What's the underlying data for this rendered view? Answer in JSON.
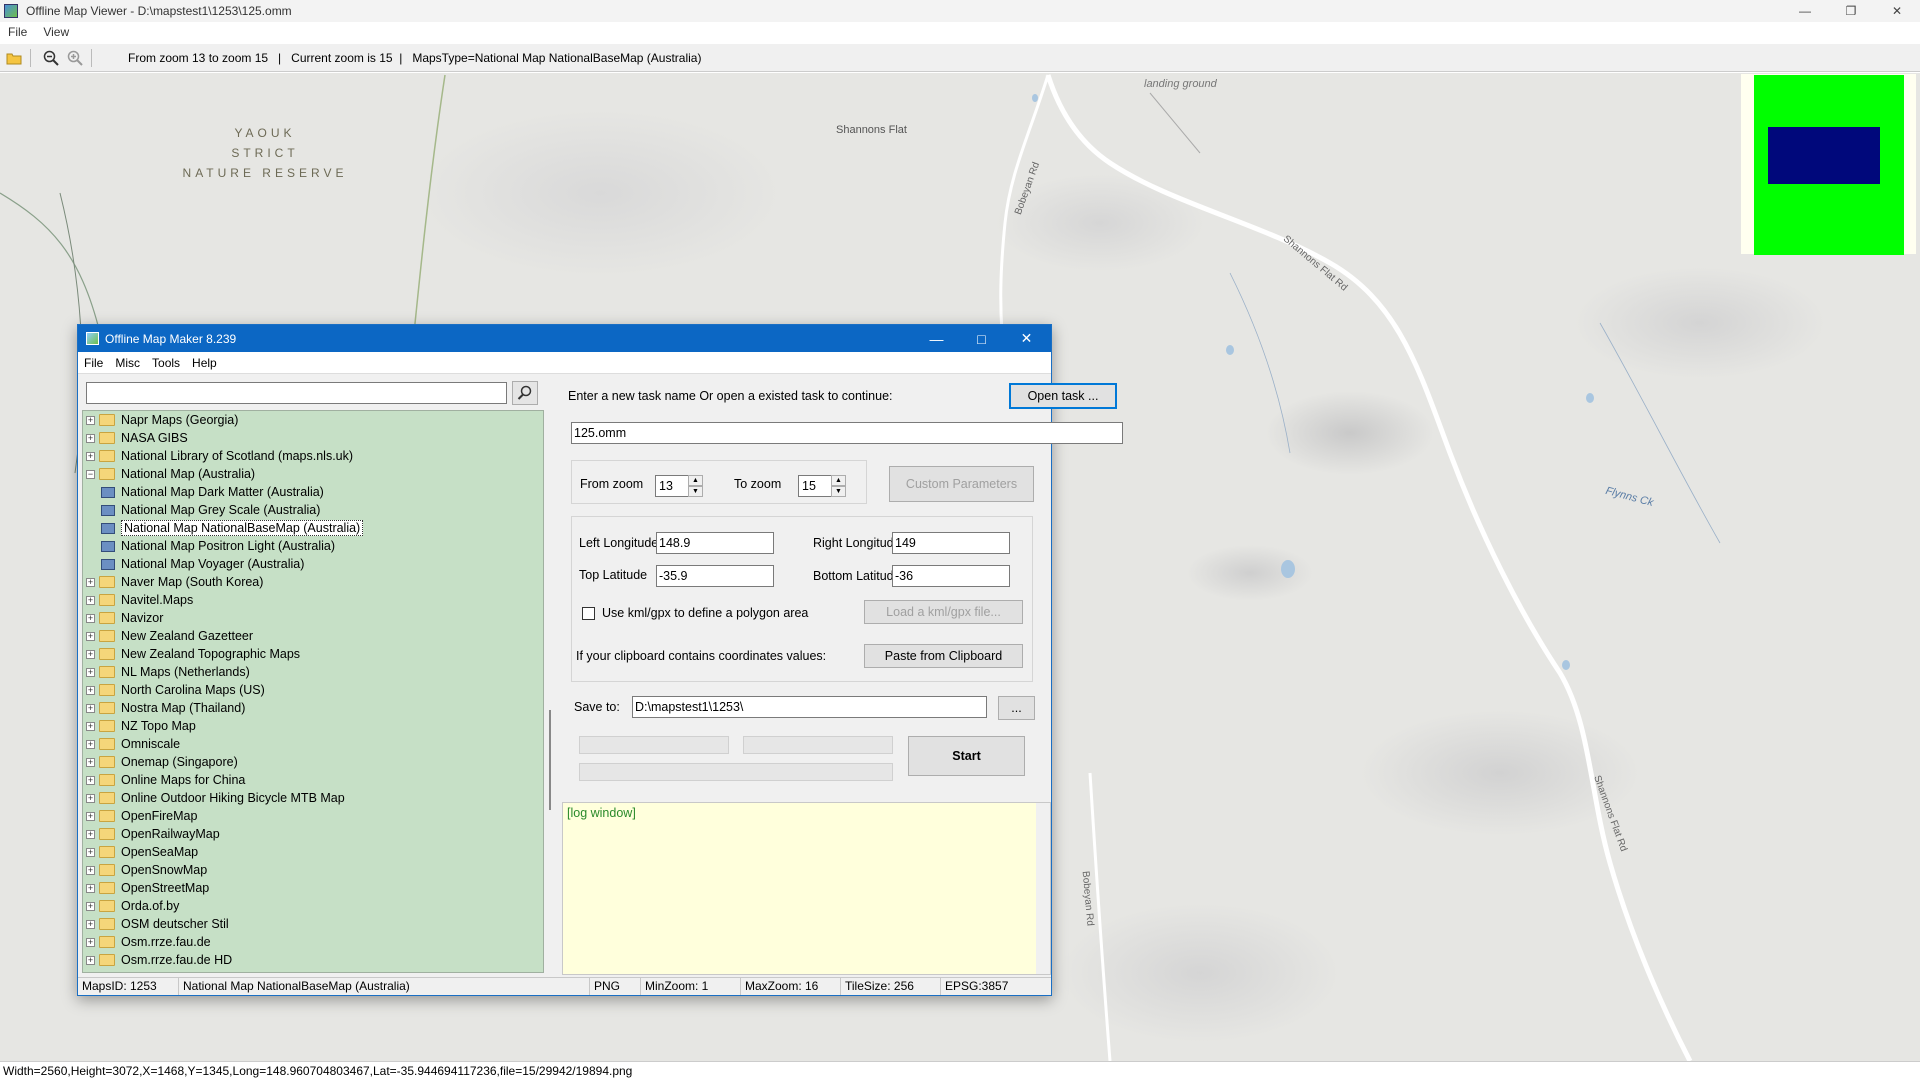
{
  "outer": {
    "title": "Offline Map Viewer - D:\\mapstest1\\1253\\125.omm",
    "menu": [
      "File",
      "View"
    ],
    "toolbar_info": "From zoom 13 to zoom 15   |   Current zoom is 15  |   MapsType=National Map NationalBaseMap (Australia)",
    "status": "Width=2560,Height=3072,X=1468,Y=1345,Long=148.960704803467,Lat=-35.944694117236,file=15/29942/19894.png"
  },
  "map_labels": {
    "reserve": [
      "YAOUK",
      "STRICT",
      "NATURE RESERVE"
    ],
    "shannons_flat": "Shannons Flat",
    "landing_ground": "landing ground",
    "bobeyan_rd": "Bobeyan Rd",
    "shannons_flat_rd": "Shannons Flat Rd",
    "flynns_ck": "Flynns Ck"
  },
  "minimap_colors": {
    "frame": "#00ff00",
    "viewport": "#00087b"
  },
  "dialog": {
    "title": "Offline Map Maker 8.239",
    "menu": [
      "File",
      "Misc",
      "Tools",
      "Help"
    ],
    "search_placeholder": "",
    "tree": [
      {
        "label": "Napr Maps (Georgia)",
        "type": "folder"
      },
      {
        "label": "NASA GIBS",
        "type": "folder"
      },
      {
        "label": "National Library of Scotland (maps.nls.uk)",
        "type": "folder"
      },
      {
        "label": "National Map (Australia)",
        "type": "folder-open"
      },
      {
        "label": "National Map Dark Matter (Australia)",
        "type": "map"
      },
      {
        "label": "National Map Grey Scale (Australia)",
        "type": "map"
      },
      {
        "label": "National Map NationalBaseMap (Australia)",
        "type": "map",
        "selected": true
      },
      {
        "label": "National Map Positron Light (Australia)",
        "type": "map"
      },
      {
        "label": "National Map Voyager (Australia)",
        "type": "map"
      },
      {
        "label": "Naver Map (South Korea)",
        "type": "folder"
      },
      {
        "label": "Navitel.Maps",
        "type": "folder"
      },
      {
        "label": "Navizor",
        "type": "folder"
      },
      {
        "label": "New Zealand Gazetteer",
        "type": "folder"
      },
      {
        "label": "New Zealand Topographic Maps",
        "type": "folder"
      },
      {
        "label": "NL Maps (Netherlands)",
        "type": "folder"
      },
      {
        "label": "North Carolina Maps (US)",
        "type": "folder"
      },
      {
        "label": "Nostra Map (Thailand)",
        "type": "folder"
      },
      {
        "label": "NZ Topo Map",
        "type": "folder"
      },
      {
        "label": "Omniscale",
        "type": "folder"
      },
      {
        "label": "Onemap (Singapore)",
        "type": "folder"
      },
      {
        "label": "Online Maps for China",
        "type": "folder"
      },
      {
        "label": "Online Outdoor Hiking Bicycle MTB Map",
        "type": "folder"
      },
      {
        "label": "OpenFireMap",
        "type": "folder"
      },
      {
        "label": "OpenRailwayMap",
        "type": "folder"
      },
      {
        "label": "OpenSeaMap",
        "type": "folder"
      },
      {
        "label": "OpenSnowMap",
        "type": "folder"
      },
      {
        "label": "OpenStreetMap",
        "type": "folder"
      },
      {
        "label": "Orda.of.by",
        "type": "folder"
      },
      {
        "label": "OSM deutscher Stil",
        "type": "folder"
      },
      {
        "label": "Osm.rrze.fau.de",
        "type": "folder"
      },
      {
        "label": "Osm.rrze.fau.de HD",
        "type": "folder"
      }
    ],
    "task_prompt": "Enter a new task name Or open a existed task to continue:",
    "open_task_btn": "Open task ...",
    "task_name": "125.omm",
    "from_zoom_label": "From zoom",
    "from_zoom": "13",
    "to_zoom_label": "To zoom",
    "to_zoom": "15",
    "custom_params_btn": "Custom Parameters",
    "left_lon_label": "Left Longitude",
    "left_lon": "148.9",
    "right_lon_label": "Right Longitude",
    "right_lon": "149",
    "top_lat_label": "Top Latitude",
    "top_lat": "-35.9",
    "bottom_lat_label": "Bottom Latitude",
    "bottom_lat": "-36",
    "kml_check_label": "Use kml/gpx to define a polygon area",
    "load_kml_btn": "Load a kml/gpx file...",
    "clipboard_label": "If your clipboard contains coordinates values:",
    "paste_btn": "Paste from Clipboard",
    "save_to_label": "Save to:",
    "save_to": "D:\\mapstest1\\1253\\",
    "browse_btn": "...",
    "start_btn": "Start",
    "log_text": "[log window]",
    "status": {
      "maps_id": "MapsID: 1253",
      "map_name": "National Map NationalBaseMap (Australia)",
      "format": "PNG",
      "min_zoom": "MinZoom: 1",
      "max_zoom": "MaxZoom: 16",
      "tile_size": "TileSize: 256",
      "epsg": "EPSG:3857"
    }
  }
}
